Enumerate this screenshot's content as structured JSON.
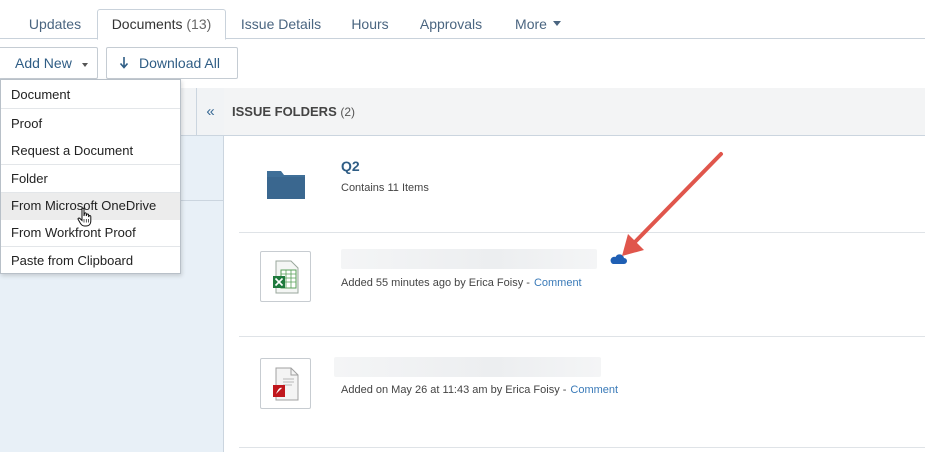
{
  "tabs": [
    {
      "label": "Updates"
    },
    {
      "label": "Documents",
      "count": "(13)"
    },
    {
      "label": "Issue Details"
    },
    {
      "label": "Hours"
    },
    {
      "label": "Approvals"
    },
    {
      "label": "More"
    }
  ],
  "toolbar": {
    "add_new_label": "Add New",
    "download_all_label": "Download All"
  },
  "add_new_menu": {
    "items": [
      {
        "label": "Document"
      },
      {
        "label": "Proof"
      },
      {
        "label": "Request a Document"
      },
      {
        "label": "Folder"
      },
      {
        "label": "From Microsoft OneDrive"
      },
      {
        "label": "From Workfront Proof"
      },
      {
        "label": "Paste from Clipboard"
      }
    ],
    "hovered_item": "From Microsoft OneDrive"
  },
  "panel": {
    "collapse_glyph": "«"
  },
  "section": {
    "title": "ISSUE FOLDERS",
    "count": "(2)"
  },
  "rows": [
    {
      "type": "folder",
      "name": "Q2",
      "meta": "Contains 11 Items"
    },
    {
      "type": "excel",
      "meta": "Added 55 minutes ago by Erica Foisy -",
      "action": "Comment",
      "source_icon": "onedrive-cloud-icon"
    },
    {
      "type": "pdf",
      "meta": "Added on May 26 at 11:43 am by Erica Foisy -",
      "action": "Comment"
    }
  ],
  "colors": {
    "link": "#2f5d85",
    "folder": "#3f6f98",
    "arrow": "#e0564c",
    "onedrive": "#1f5fb4"
  }
}
